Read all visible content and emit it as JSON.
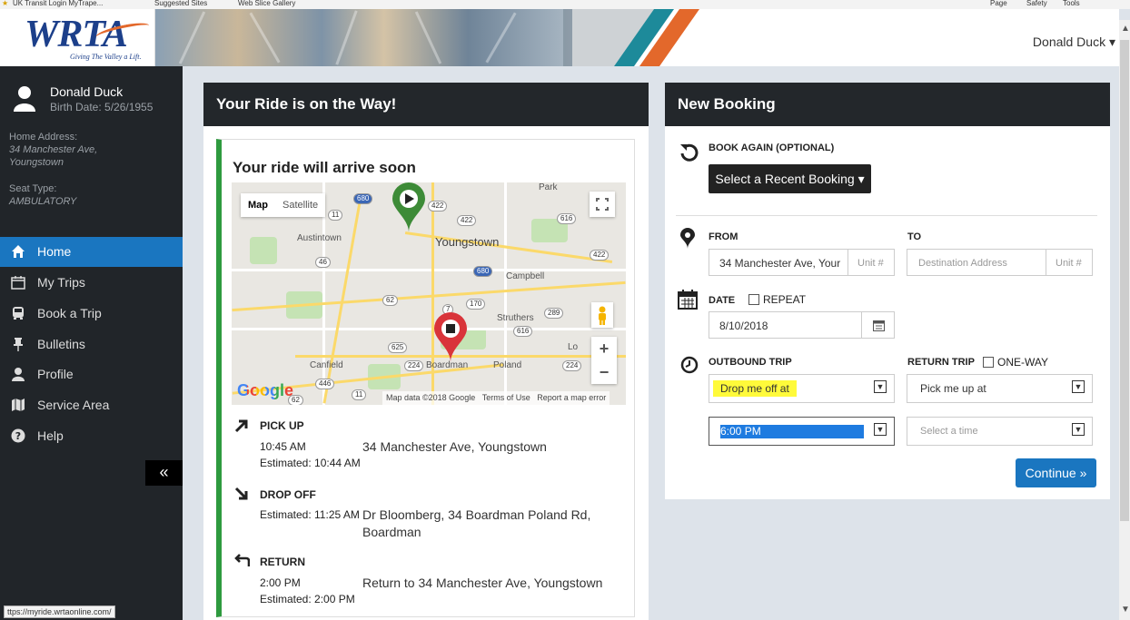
{
  "browser": {
    "fav1": "UK Transit Login  MyTrape...",
    "fav2": "Suggested Sites",
    "fav3": "Web Slice Gallery",
    "menu_page": "Page",
    "menu_safety": "Safety",
    "menu_tools": "Tools",
    "status_url": "ttps://myride.wrtaonline.com/"
  },
  "header": {
    "logo_text": "WRTA",
    "logo_tagline": "Giving The Valley a Lift.",
    "user_menu": "Donald Duck ▾"
  },
  "sidebar": {
    "user_name": "Donald Duck",
    "birth": "Birth Date: 5/26/1955",
    "home_label": "Home Address:",
    "home_line1": "34 Manchester Ave,",
    "home_line2": "Youngstown",
    "seat_label": "Seat Type:",
    "seat_value": "AMBULATORY",
    "nav": [
      {
        "label": "Home",
        "icon": "home-icon"
      },
      {
        "label": "My Trips",
        "icon": "calendar-icon"
      },
      {
        "label": "Book a Trip",
        "icon": "bus-icon"
      },
      {
        "label": "Bulletins",
        "icon": "pin-icon"
      },
      {
        "label": "Profile",
        "icon": "user-icon"
      },
      {
        "label": "Service Area",
        "icon": "map-icon"
      },
      {
        "label": "Help",
        "icon": "help-icon"
      }
    ],
    "collapse_label": "«"
  },
  "ride": {
    "panel_title": "Your Ride is on the Way!",
    "subtitle": "Your ride will arrive soon",
    "map": {
      "tab_map": "Map",
      "tab_satellite": "Satellite",
      "attribution": "Map data ©2018 Google",
      "terms": "Terms of Use",
      "report": "Report a map error",
      "google": "Google",
      "places": [
        "Park",
        "Austintown",
        "Youngstown",
        "Campbell",
        "Struthers",
        "Canfield",
        "Boardman",
        "Poland",
        "Lo"
      ],
      "shields": [
        "680",
        "422",
        "422",
        "616",
        "11",
        "46",
        "422",
        "680",
        "62",
        "7",
        "170",
        "289",
        "616",
        "625",
        "224",
        "224",
        "446",
        "11",
        "62"
      ],
      "zoom_in": "+",
      "zoom_out": "−"
    },
    "pickup": {
      "title": "PICK UP",
      "time": "10:45 AM",
      "estimated": "Estimated: 10:44 AM",
      "address": "34 Manchester Ave, Youngstown"
    },
    "dropoff": {
      "title": "DROP OFF",
      "estimated": "Estimated: 11:25 AM",
      "address_line1": "Dr Bloomberg, 34 Boardman Poland Rd,",
      "address_line2": "Boardman"
    },
    "return": {
      "title": "RETURN",
      "time": "2:00 PM",
      "estimated": "Estimated: 2:00 PM",
      "address": "Return to 34 Manchester Ave, Youngstown"
    }
  },
  "booking": {
    "panel_title": "New Booking",
    "book_again_label": "BOOK AGAIN (OPTIONAL)",
    "recent_button": "Select a Recent Booking ▾",
    "from_label": "FROM",
    "to_label": "TO",
    "from_value": "34 Manchester Ave, Your",
    "unit_placeholder": "Unit #",
    "to_placeholder": "Destination Address",
    "date_label": "DATE",
    "repeat_label": "REPEAT",
    "date_value": "8/10/2018",
    "outbound_label": "OUTBOUND TRIP",
    "return_label": "RETURN TRIP",
    "oneway_label": "ONE-WAY",
    "outbound_mode": "Drop me off at",
    "return_mode": "Pick me up at",
    "outbound_time": "6:00 PM",
    "return_time_placeholder": "Select a time",
    "continue_button": "Continue »"
  },
  "colors": {
    "accent": "#1a76c0",
    "sidebar_bg": "#212529",
    "panel_head": "#23272b",
    "highlight": "#fffa3a",
    "pickup_pin": "#3d8b37",
    "dropoff_pin": "#d9343a",
    "ride_border": "#2e9a3f"
  }
}
